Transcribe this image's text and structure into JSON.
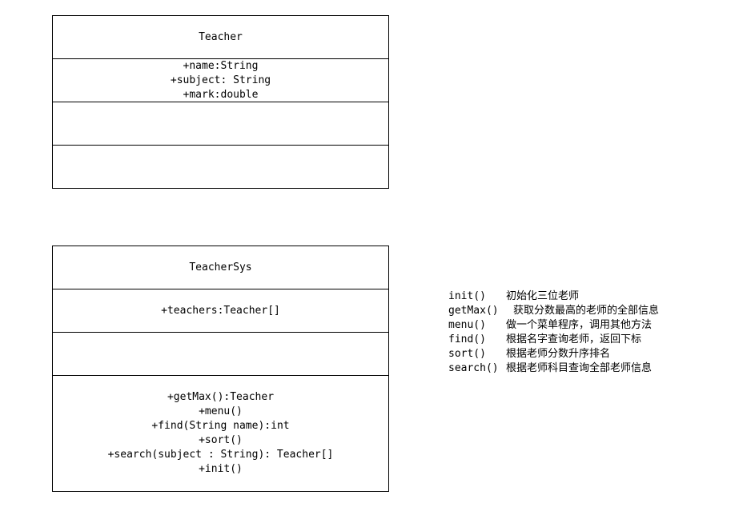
{
  "classes": [
    {
      "name": "Teacher",
      "attributes": [
        "+name:String",
        "+subject: String",
        "+mark:double"
      ],
      "operations": []
    },
    {
      "name": "TeacherSys",
      "attributes": [
        "+teachers:Teacher[]"
      ],
      "operations": [
        "+getMax():Teacher",
        "+menu()",
        "+find(String name):int",
        "+sort()",
        "+search(subject : String): Teacher[]",
        "+init()"
      ]
    }
  ],
  "notes": [
    {
      "method": "init()",
      "description": "初始化三位老师"
    },
    {
      "method": "getMax()",
      "description": "获取分数最高的老师的全部信息"
    },
    {
      "method": "menu()",
      "description": "做一个菜单程序，调用其他方法"
    },
    {
      "method": "find()",
      "description": "根据名字查询老师，返回下标"
    },
    {
      "method": "sort()",
      "description": "根据老师分数升序排名"
    },
    {
      "method": "search()",
      "description": "根据老师科目查询全部老师信息"
    }
  ]
}
